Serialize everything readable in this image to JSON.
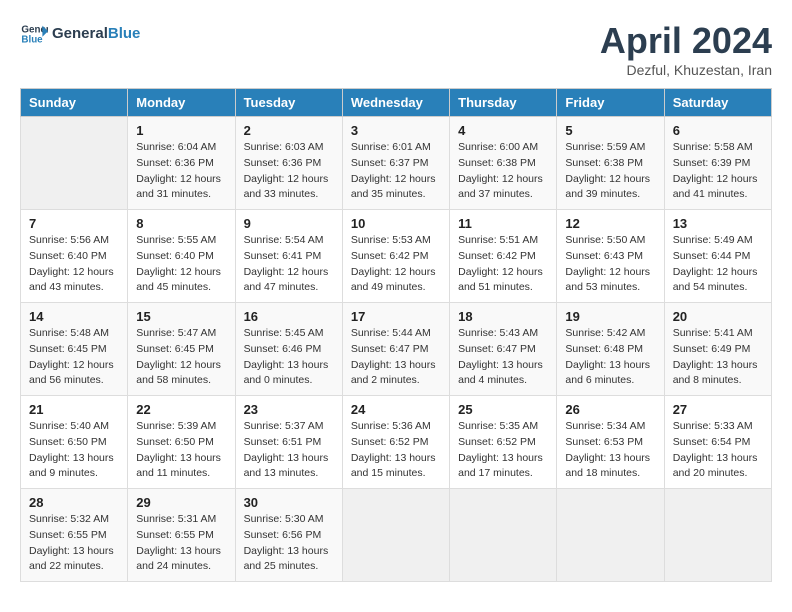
{
  "header": {
    "logo_line1": "General",
    "logo_line2": "Blue",
    "month_title": "April 2024",
    "subtitle": "Dezful, Khuzestan, Iran"
  },
  "weekdays": [
    "Sunday",
    "Monday",
    "Tuesday",
    "Wednesday",
    "Thursday",
    "Friday",
    "Saturday"
  ],
  "weeks": [
    [
      {
        "day": "",
        "info": ""
      },
      {
        "day": "1",
        "info": "Sunrise: 6:04 AM\nSunset: 6:36 PM\nDaylight: 12 hours\nand 31 minutes."
      },
      {
        "day": "2",
        "info": "Sunrise: 6:03 AM\nSunset: 6:36 PM\nDaylight: 12 hours\nand 33 minutes."
      },
      {
        "day": "3",
        "info": "Sunrise: 6:01 AM\nSunset: 6:37 PM\nDaylight: 12 hours\nand 35 minutes."
      },
      {
        "day": "4",
        "info": "Sunrise: 6:00 AM\nSunset: 6:38 PM\nDaylight: 12 hours\nand 37 minutes."
      },
      {
        "day": "5",
        "info": "Sunrise: 5:59 AM\nSunset: 6:38 PM\nDaylight: 12 hours\nand 39 minutes."
      },
      {
        "day": "6",
        "info": "Sunrise: 5:58 AM\nSunset: 6:39 PM\nDaylight: 12 hours\nand 41 minutes."
      }
    ],
    [
      {
        "day": "7",
        "info": "Sunrise: 5:56 AM\nSunset: 6:40 PM\nDaylight: 12 hours\nand 43 minutes."
      },
      {
        "day": "8",
        "info": "Sunrise: 5:55 AM\nSunset: 6:40 PM\nDaylight: 12 hours\nand 45 minutes."
      },
      {
        "day": "9",
        "info": "Sunrise: 5:54 AM\nSunset: 6:41 PM\nDaylight: 12 hours\nand 47 minutes."
      },
      {
        "day": "10",
        "info": "Sunrise: 5:53 AM\nSunset: 6:42 PM\nDaylight: 12 hours\nand 49 minutes."
      },
      {
        "day": "11",
        "info": "Sunrise: 5:51 AM\nSunset: 6:42 PM\nDaylight: 12 hours\nand 51 minutes."
      },
      {
        "day": "12",
        "info": "Sunrise: 5:50 AM\nSunset: 6:43 PM\nDaylight: 12 hours\nand 53 minutes."
      },
      {
        "day": "13",
        "info": "Sunrise: 5:49 AM\nSunset: 6:44 PM\nDaylight: 12 hours\nand 54 minutes."
      }
    ],
    [
      {
        "day": "14",
        "info": "Sunrise: 5:48 AM\nSunset: 6:45 PM\nDaylight: 12 hours\nand 56 minutes."
      },
      {
        "day": "15",
        "info": "Sunrise: 5:47 AM\nSunset: 6:45 PM\nDaylight: 12 hours\nand 58 minutes."
      },
      {
        "day": "16",
        "info": "Sunrise: 5:45 AM\nSunset: 6:46 PM\nDaylight: 13 hours\nand 0 minutes."
      },
      {
        "day": "17",
        "info": "Sunrise: 5:44 AM\nSunset: 6:47 PM\nDaylight: 13 hours\nand 2 minutes."
      },
      {
        "day": "18",
        "info": "Sunrise: 5:43 AM\nSunset: 6:47 PM\nDaylight: 13 hours\nand 4 minutes."
      },
      {
        "day": "19",
        "info": "Sunrise: 5:42 AM\nSunset: 6:48 PM\nDaylight: 13 hours\nand 6 minutes."
      },
      {
        "day": "20",
        "info": "Sunrise: 5:41 AM\nSunset: 6:49 PM\nDaylight: 13 hours\nand 8 minutes."
      }
    ],
    [
      {
        "day": "21",
        "info": "Sunrise: 5:40 AM\nSunset: 6:50 PM\nDaylight: 13 hours\nand 9 minutes."
      },
      {
        "day": "22",
        "info": "Sunrise: 5:39 AM\nSunset: 6:50 PM\nDaylight: 13 hours\nand 11 minutes."
      },
      {
        "day": "23",
        "info": "Sunrise: 5:37 AM\nSunset: 6:51 PM\nDaylight: 13 hours\nand 13 minutes."
      },
      {
        "day": "24",
        "info": "Sunrise: 5:36 AM\nSunset: 6:52 PM\nDaylight: 13 hours\nand 15 minutes."
      },
      {
        "day": "25",
        "info": "Sunrise: 5:35 AM\nSunset: 6:52 PM\nDaylight: 13 hours\nand 17 minutes."
      },
      {
        "day": "26",
        "info": "Sunrise: 5:34 AM\nSunset: 6:53 PM\nDaylight: 13 hours\nand 18 minutes."
      },
      {
        "day": "27",
        "info": "Sunrise: 5:33 AM\nSunset: 6:54 PM\nDaylight: 13 hours\nand 20 minutes."
      }
    ],
    [
      {
        "day": "28",
        "info": "Sunrise: 5:32 AM\nSunset: 6:55 PM\nDaylight: 13 hours\nand 22 minutes."
      },
      {
        "day": "29",
        "info": "Sunrise: 5:31 AM\nSunset: 6:55 PM\nDaylight: 13 hours\nand 24 minutes."
      },
      {
        "day": "30",
        "info": "Sunrise: 5:30 AM\nSunset: 6:56 PM\nDaylight: 13 hours\nand 25 minutes."
      },
      {
        "day": "",
        "info": ""
      },
      {
        "day": "",
        "info": ""
      },
      {
        "day": "",
        "info": ""
      },
      {
        "day": "",
        "info": ""
      }
    ]
  ]
}
